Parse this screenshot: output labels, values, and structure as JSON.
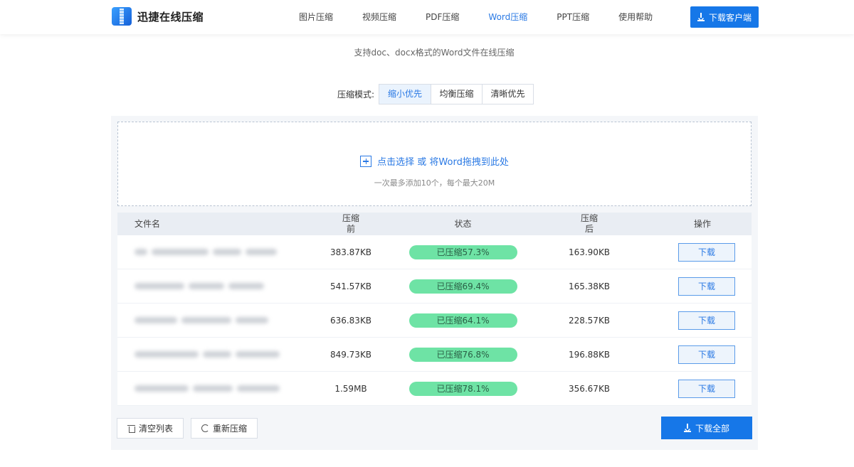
{
  "app": {
    "name": "迅捷在线压缩",
    "accent_color": "#1677e8",
    "logo_icon": "zip-file-icon"
  },
  "nav": {
    "items": [
      {
        "label": "图片压缩",
        "active": false
      },
      {
        "label": "视频压缩",
        "active": false
      },
      {
        "label": "PDF压缩",
        "active": false
      },
      {
        "label": "Word压缩",
        "active": true
      },
      {
        "label": "PPT压缩",
        "active": false
      },
      {
        "label": "使用帮助",
        "active": false
      }
    ],
    "download_client": "下载客户端"
  },
  "subtitle": "支持doc、docx格式的Word文件在线压缩",
  "modes": {
    "label": "压缩模式:",
    "options": [
      {
        "label": "缩小优先",
        "active": true
      },
      {
        "label": "均衡压缩",
        "active": false
      },
      {
        "label": "清晰优先",
        "active": false
      }
    ]
  },
  "dropzone": {
    "main": "点击选择 或 将Word拖拽到此处",
    "hint": "一次最多添加10个，每个最大20M"
  },
  "table": {
    "headers": {
      "filename": "文件名",
      "before_line1": "压缩",
      "before_line2": "前",
      "status": "状态",
      "after_line1": "压缩",
      "after_line2": "后",
      "action": "操作"
    },
    "rows": [
      {
        "before": "383.87KB",
        "status": "已压缩57.3%",
        "after": "163.90KB",
        "action": "下载"
      },
      {
        "before": "541.57KB",
        "status": "已压缩69.4%",
        "after": "165.38KB",
        "action": "下载"
      },
      {
        "before": "636.83KB",
        "status": "已压缩64.1%",
        "after": "228.57KB",
        "action": "下载"
      },
      {
        "before": "849.73KB",
        "status": "已压缩76.8%",
        "after": "196.88KB",
        "action": "下载"
      },
      {
        "before": "1.59MB",
        "status": "已压缩78.1%",
        "after": "356.67KB",
        "action": "下载"
      }
    ]
  },
  "footer": {
    "clear": "清空列表",
    "recompress": "重新压缩",
    "download_all": "下载全部"
  }
}
